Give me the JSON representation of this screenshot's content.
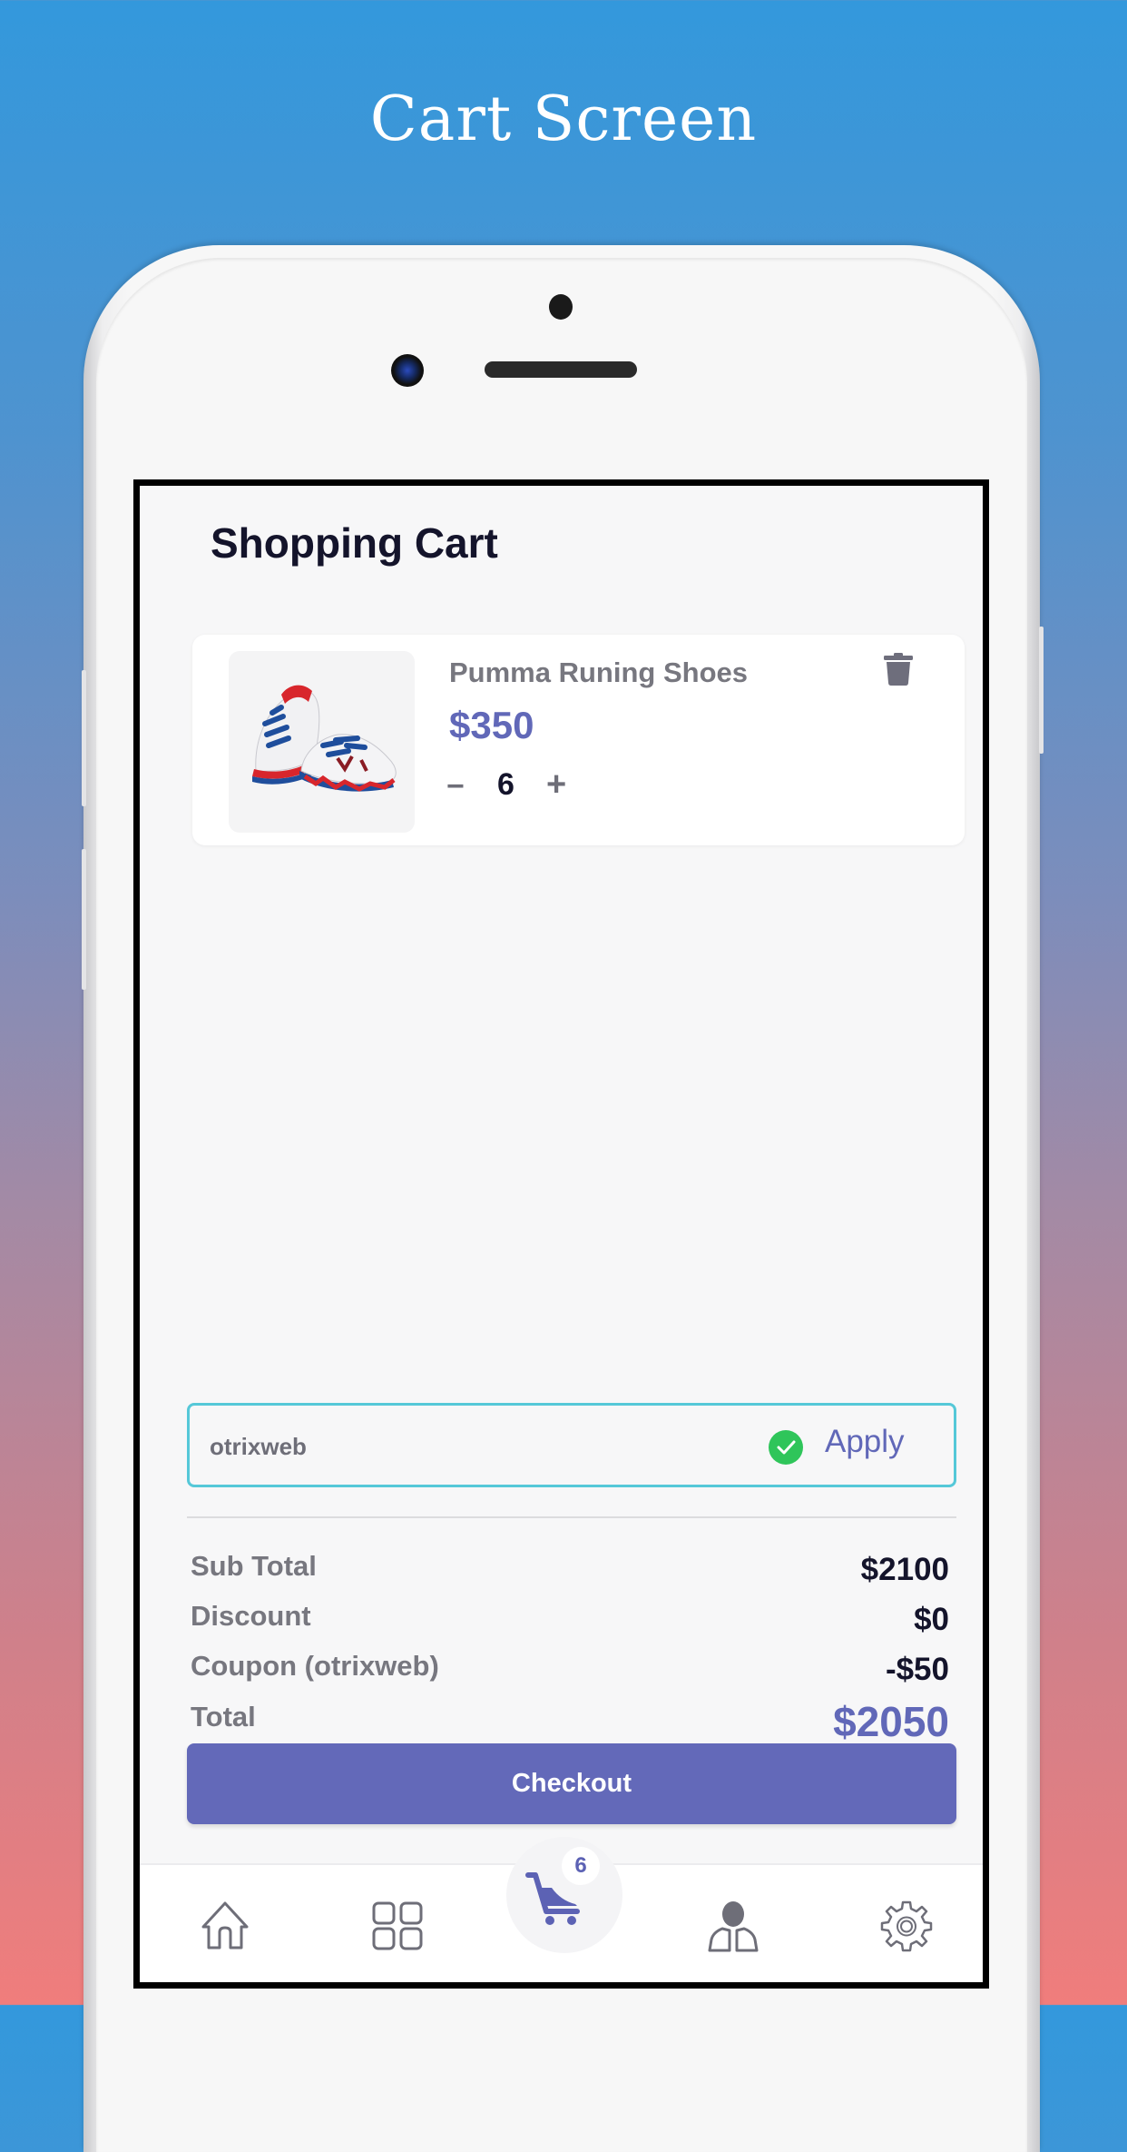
{
  "promo": {
    "title": "Cart Screen"
  },
  "colors": {
    "accent": "#6369b9",
    "price": "#6168b8",
    "coupon_border": "#55c8d8",
    "success": "#2fc55a",
    "text_dark": "#14142b",
    "text_muted": "#77777f"
  },
  "page": {
    "title": "Shopping Cart"
  },
  "cart": {
    "items": [
      {
        "name": "Pumma Runing Shoes",
        "price": "$350",
        "quantity": "6",
        "image_icon": "running-shoes-image",
        "minus_label": "−",
        "plus_label": "+",
        "delete_icon": "trash-icon"
      }
    ]
  },
  "coupon": {
    "value": "otrixweb",
    "status_icon": "check-circle-icon",
    "apply_label": "Apply"
  },
  "summary": {
    "rows": [
      {
        "label": "Sub Total",
        "value": "$2100"
      },
      {
        "label": "Discount",
        "value": "$0"
      },
      {
        "label": "Coupon (otrixweb)",
        "value": "-$50"
      },
      {
        "label": "Total",
        "value": "$2050"
      }
    ]
  },
  "checkout": {
    "label": "Checkout"
  },
  "bottom_nav": {
    "items": [
      {
        "name": "home",
        "icon": "home-icon"
      },
      {
        "name": "categories",
        "icon": "grid-icon"
      },
      {
        "name": "cart",
        "icon": "cart-icon",
        "badge": "6",
        "active": true
      },
      {
        "name": "profile",
        "icon": "user-icon"
      },
      {
        "name": "settings",
        "icon": "gear-icon"
      }
    ]
  }
}
